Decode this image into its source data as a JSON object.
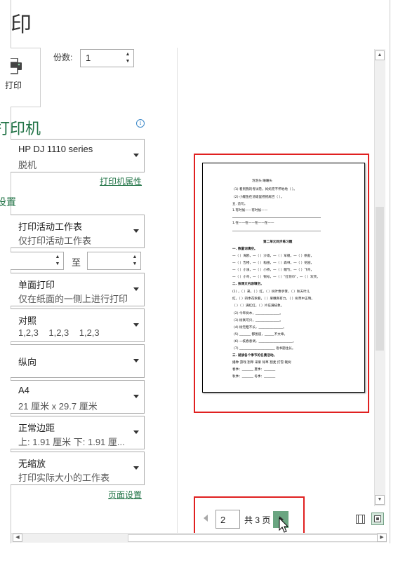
{
  "title": "印",
  "print_button_label": "打印",
  "copies": {
    "label": "份数:",
    "value": "1"
  },
  "printer": {
    "heading": "打印机",
    "name": "HP DJ 1110 series",
    "status": "脱机",
    "properties_link": "打印机属性"
  },
  "settings": {
    "heading": "设置",
    "dropdowns": [
      {
        "line1": "打印活动工作表",
        "line2": "仅打印活动工作表"
      },
      {
        "line1": "单面打印",
        "line2": "仅在纸面的一侧上进行打印"
      },
      {
        "line1": "对照",
        "line2": "1,2,3    1,2,3    1,2,3"
      },
      {
        "line1": "纵向",
        "line2": ""
      },
      {
        "line1": "A4",
        "line2": "21 厘米 x 29.7 厘米"
      },
      {
        "line1": "正常边距",
        "line2": "上: 1.91 厘米 下: 1.91 厘..."
      },
      {
        "line1": "无缩放",
        "line2": "打印实际大小的工作表"
      }
    ],
    "pages_to_label": "至",
    "page_setup_link": "页面设置"
  },
  "preview": {
    "lines": [
      "泡泡头    睡睡头",
      "(1) 看到我的考试卷，妈妈完不怀地地（    ）。",
      "(2) 小鲤鱼在池塘里摇摇尾巴（    ）。",
      "五. 造句。",
      "1.有时候——有时候——",
      "1.在——在——在——在——",
      "第二单元同步练习题",
      "一. 数量词填空。",
      "一（ ）海鸥，一（ ）沙滩，一（ ）军舰，一（ ）帆船，",
      "一（ ）告楼，一（ ）稻田，一（ ）森林，一（ ）花园，",
      "一（ ）小溪，一（ ）小桥，一（ ）鲤竹，一（ ）飞鸟，",
      "一（ ）小鸟，一（ ）铜号，一（ ）\"红领巾\"，一（ ）欢笑。",
      "二. 按课文内容填空。",
      "(1) ，（ ）来，（ ）红，（ ）树叶像手掌，（ ）秋天叶儿",
      "红，（ ）四季花秋看，（ ）果穗真有力，（ ）树草中正晴。",
      "（ ）（ ）满红红，（ ）片在满枝象。",
      "(2) 今年树木，_______________。",
      "(3) 树真可兴，_______________。",
      "(4) 树无粗不长，_______________。",
      "(5) _______ 都围道，______不文章。",
      "(6) 一枝春意调，_____________________。",
      "(7) ______________________ 语书题往长。",
      "三. 就读各个季节的名景活动。",
      "播种  游戏  割草  采果  除草  割麦  打雪  栽树",
      "春季：_______    夏季：_______",
      "秋季：_______    冬季：_______"
    ]
  },
  "pager": {
    "current_page": "2",
    "total_label": "共 3 页"
  },
  "colors": {
    "accent": "#217346",
    "highlight": "#e02020",
    "next_button": "#6aa581"
  },
  "icons": {
    "printer": "printer-icon",
    "info": "info-icon",
    "prev": "chevron-left-icon",
    "next": "chevron-right-icon",
    "show_margins": "show-margins-icon",
    "zoom_to_page": "zoom-to-page-icon"
  }
}
